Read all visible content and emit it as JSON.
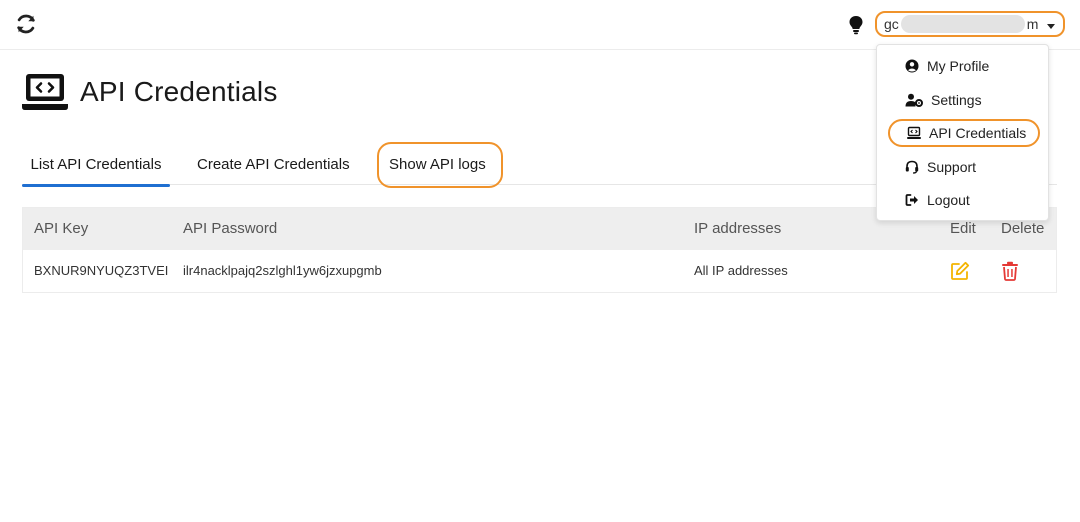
{
  "topbar": {
    "user_start": "gc",
    "user_end": "m"
  },
  "page": {
    "title": "API Credentials"
  },
  "tabs": [
    {
      "label": "List API Credentials"
    },
    {
      "label": "Create API Credentials"
    },
    {
      "label": "Show API logs"
    }
  ],
  "table": {
    "columns": [
      "API Key",
      "API Password",
      "IP addresses",
      "Edit",
      "Delete"
    ],
    "rows": [
      {
        "api_key": "BXNUR9NYUQZ3TVEI",
        "api_password": "ilr4nacklpajq2szlghl1yw6jzxupgmb",
        "ip": "All IP addresses"
      }
    ]
  },
  "menu": {
    "items": [
      {
        "label": "My Profile",
        "icon": "user-circle-icon"
      },
      {
        "label": "Settings",
        "icon": "user-gear-icon"
      },
      {
        "label": "API Credentials",
        "icon": "laptop-code-icon"
      },
      {
        "label": "Support",
        "icon": "headset-icon"
      },
      {
        "label": "Logout",
        "icon": "sign-out-icon"
      }
    ]
  },
  "colors": {
    "highlight": "#f0932b",
    "active_tab": "#1f6fd1",
    "edit": "#f4b400",
    "delete": "#e53935"
  }
}
